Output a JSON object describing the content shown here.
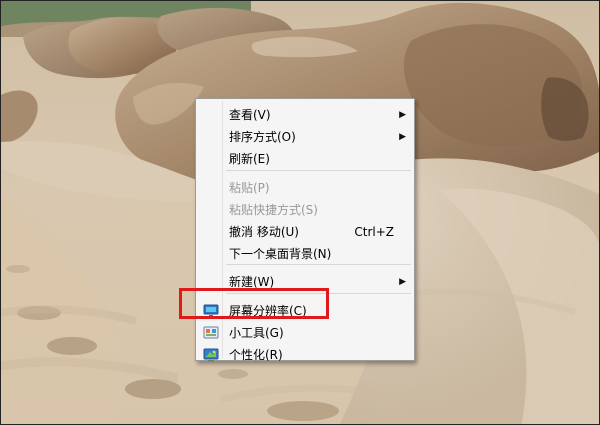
{
  "menu": {
    "items": [
      {
        "label": "查看(V)",
        "shortcut": "",
        "submenu": true,
        "disabled": false,
        "icon": ""
      },
      {
        "label": "排序方式(O)",
        "shortcut": "",
        "submenu": true,
        "disabled": false,
        "icon": ""
      },
      {
        "label": "刷新(E)",
        "shortcut": "",
        "submenu": false,
        "disabled": false,
        "icon": ""
      },
      {
        "label": "粘贴(P)",
        "shortcut": "",
        "submenu": false,
        "disabled": true,
        "icon": ""
      },
      {
        "label": "粘贴快捷方式(S)",
        "shortcut": "",
        "submenu": false,
        "disabled": true,
        "icon": ""
      },
      {
        "label": "撤消 移动(U)",
        "shortcut": "Ctrl+Z",
        "submenu": false,
        "disabled": false,
        "icon": ""
      },
      {
        "label": "下一个桌面背景(N)",
        "shortcut": "",
        "submenu": false,
        "disabled": false,
        "icon": ""
      },
      {
        "label": "新建(W)",
        "shortcut": "",
        "submenu": true,
        "disabled": false,
        "icon": ""
      },
      {
        "label": "屏幕分辨率(C)",
        "shortcut": "",
        "submenu": false,
        "disabled": false,
        "icon": "monitor-icon"
      },
      {
        "label": "小工具(G)",
        "shortcut": "",
        "submenu": false,
        "disabled": false,
        "icon": "gadgets-icon"
      },
      {
        "label": "个性化(R)",
        "shortcut": "",
        "submenu": false,
        "disabled": false,
        "icon": "personalize-icon"
      }
    ],
    "submenu_arrow": "▶"
  },
  "annotation": {
    "highlight_color": "#e01a1a"
  }
}
